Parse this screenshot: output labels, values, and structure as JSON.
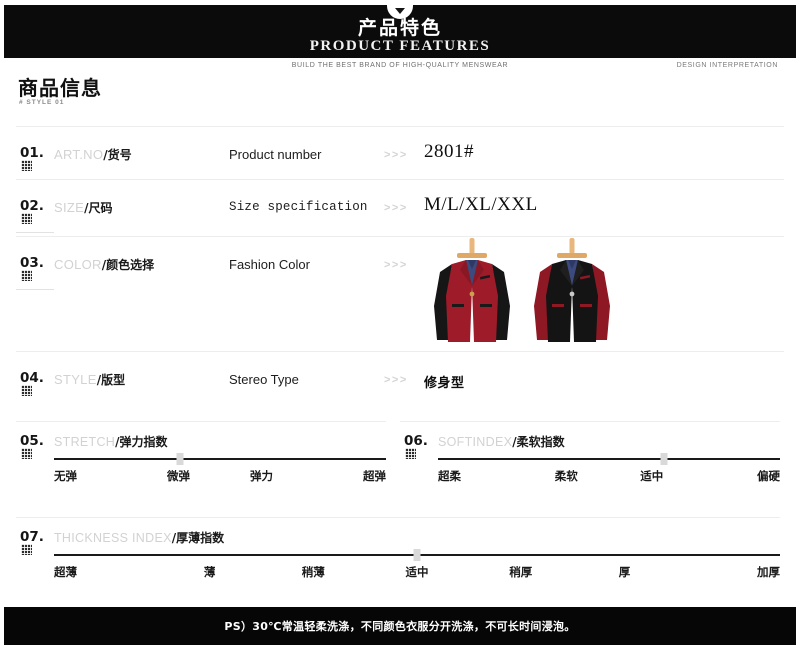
{
  "banner": {
    "title_cn": "产品特色",
    "title_en": "PRODUCT FEATURES",
    "tagline": "BUILD THE BEST BRAND OF HIGH-QUALITY MENSWEAR",
    "right_label": "DESIGN INTERPRETATION"
  },
  "section": {
    "title": "商品信息",
    "subtitle": "# STYLE 01"
  },
  "arrows": ">>>",
  "rows": [
    {
      "num": "01.",
      "label_en": "ART.NO",
      "label_cn": "/货号",
      "desc": "Product number",
      "value": "2801#"
    },
    {
      "num": "02.",
      "label_en": "SIZE",
      "label_cn": "/尺码",
      "desc": "Size specification",
      "value": "M/L/XL/XXL"
    },
    {
      "num": "03.",
      "label_en": "COLOR",
      "label_cn": "/颜色选择",
      "desc": "Fashion Color",
      "value": ""
    },
    {
      "num": "04.",
      "label_en": "STYLE",
      "label_cn": "/版型",
      "desc": "Stereo Type",
      "value": "修身型"
    }
  ],
  "garments": [
    {
      "name": "red-body-black-sleeve-blazer",
      "body_color": "#9e1b2a",
      "sleeve_color": "#161616",
      "shirt_color": "#3c4a7e"
    },
    {
      "name": "black-body-red-sleeve-blazer",
      "body_color": "#141414",
      "sleeve_color": "#8e1824",
      "shirt_color": "#3c4a7e"
    }
  ],
  "scales": [
    {
      "num": "05.",
      "label_en": "STRETCH",
      "label_cn": "/弹力指数",
      "labels": [
        "无弹",
        "微弹",
        "弹力",
        "超弹"
      ],
      "marker_index": 1,
      "marker_percent": 38
    },
    {
      "num": "06.",
      "label_en": "SOFTINDEX",
      "label_cn": "/柔软指数",
      "labels": [
        "超柔",
        "柔软",
        "适中",
        "偏硬"
      ],
      "marker_index": 2,
      "marker_percent": 66
    },
    {
      "num": "07.",
      "label_en": "THICKNESS INDEX",
      "label_cn": "/厚薄指数",
      "labels": [
        "超薄",
        "薄",
        "稍薄",
        "适中",
        "稍厚",
        "厚",
        "加厚"
      ],
      "marker_index": 3,
      "marker_percent": 50
    }
  ],
  "footer": {
    "text": "PS）30℃常温轻柔洗涤，不同颜色衣服分开洗涤，不可长时间浸泡。"
  }
}
